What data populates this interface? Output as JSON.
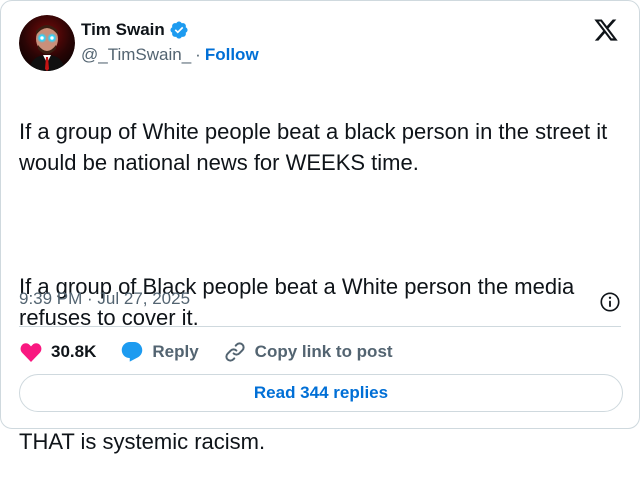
{
  "author": {
    "display_name": "Tim Swain",
    "handle": "@_TimSwain_",
    "separator": "·",
    "follow_label": "Follow"
  },
  "tweet": {
    "paragraphs": [
      "If a group of White people beat a black person in the street it would be national news for WEEKS time.",
      "If a group of Black people beat a White person the media refuses to cover it.",
      "THAT is systemic racism."
    ],
    "timestamp": "9:39 PM · Jul 27, 2025"
  },
  "actions": {
    "like_count": "30.8K",
    "reply_label": "Reply",
    "copy_link_label": "Copy link to post"
  },
  "read_replies_label": "Read 344 replies",
  "colors": {
    "like": "#f91880",
    "reply": "#1d9bf0",
    "link": "#006fd6",
    "verified": "#1d9bf0",
    "muted": "#536471",
    "border": "#cfd9de"
  },
  "icons": [
    "verified-badge-icon",
    "x-logo-icon",
    "info-icon",
    "heart-icon",
    "reply-bubble-icon",
    "link-icon"
  ]
}
